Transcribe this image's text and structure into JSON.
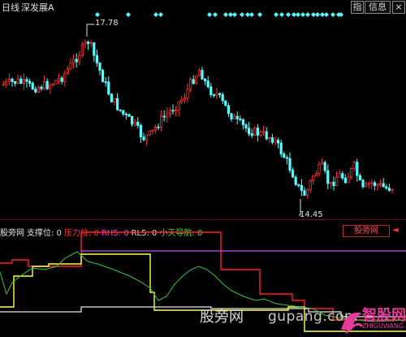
{
  "header": {
    "period": "日线",
    "stock_name": "深发展A",
    "btn_zhi": "指",
    "btn_info": "信息",
    "btn_close": "×"
  },
  "main_chart": {
    "high_label": "17.78",
    "low_label": "14.45",
    "colors": {
      "up": "#ff3030",
      "down": "#54ffff",
      "marker": "#54ffff"
    }
  },
  "sub_chart": {
    "indicator_name": "股旁网",
    "support_label": "支撑位: 0",
    "pressure_label": "压力位: 0",
    "rh5_label": "RH5: 0",
    "rl5_label": "RL5: 0",
    "nav_label": "小天导航: 0",
    "tag_label": "股旁网",
    "tag_arrow": "◄",
    "colors": {
      "red": "#ff2020",
      "yellow": "#ffff40",
      "white": "#e8e8e8",
      "purple": "#c050ff",
      "green": "#3fc23f"
    }
  },
  "watermark": {
    "cn": "股旁网",
    "en": "gupang.com",
    "logo_text": "智股网",
    "logo_sub": "ZHIGUWANG.CN"
  }
}
